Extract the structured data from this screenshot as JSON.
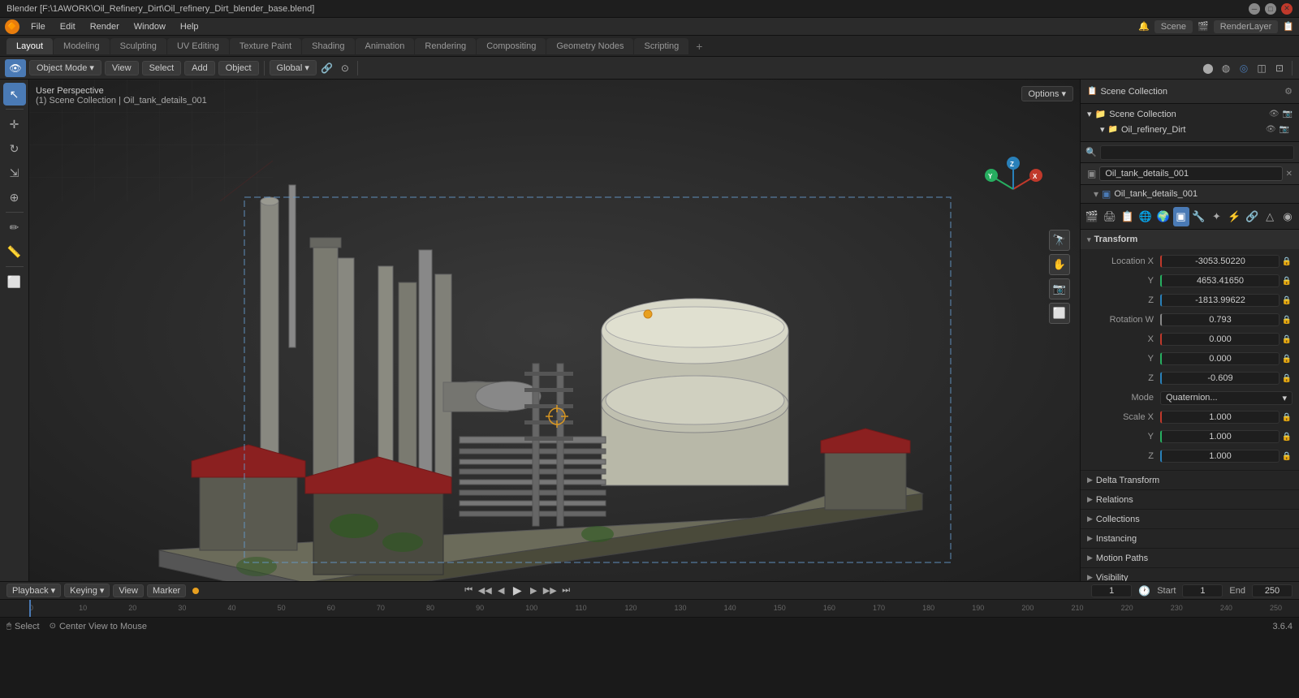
{
  "titleBar": {
    "title": "Blender [F:\\1AWORK\\Oil_Refinery_Dirt\\Oil_refinery_Dirt_blender_base.blend]",
    "minLabel": "─",
    "maxLabel": "□",
    "closeLabel": "✕"
  },
  "menuBar": {
    "items": [
      "Blender",
      "File",
      "Edit",
      "Render",
      "Window",
      "Help"
    ]
  },
  "workspaceTabs": {
    "tabs": [
      "Layout",
      "Modeling",
      "Sculpting",
      "UV Editing",
      "Texture Paint",
      "Shading",
      "Animation",
      "Rendering",
      "Compositing",
      "Geometry Nodes",
      "Scripting"
    ],
    "activeTab": "Layout",
    "plusLabel": "+"
  },
  "toolbar": {
    "modeLabel": "Object Mode",
    "viewLabel": "View",
    "selectLabel": "Select",
    "addLabel": "Add",
    "objectLabel": "Object",
    "globalLabel": "Global",
    "optionsLabel": "Options ▾"
  },
  "viewport": {
    "perspLabel": "User Perspective",
    "collectionPath": "(1) Scene Collection | Oil_tank_details_001"
  },
  "sceneCollection": {
    "rootLabel": "Scene Collection",
    "item": "Oil_refinery_Dirt"
  },
  "outliner": {
    "searchPlaceholder": "🔍",
    "selectedObject": "Oil_tank_details_001",
    "subObject": "Oil_tank_details_001"
  },
  "properties": {
    "objectName": "Oil_tank_details_001",
    "transform": {
      "sectionLabel": "Transform",
      "locationLabel": "Location X",
      "locationX": "-3053.50220",
      "locationY": "4653.41650",
      "locationZ": "-1813.99622",
      "rotationWLabel": "Rotation W",
      "rotationW": "0.793",
      "rotationX": "0.000",
      "rotationY": "0.000",
      "rotationZ": "-0.609",
      "modeLabel": "Mode",
      "modeValue": "Quaternion...",
      "scaleLabel": "Scale X",
      "scaleX": "1.000",
      "scaleY": "1.000",
      "scaleZ": "1.000"
    },
    "collapseItems": [
      {
        "label": "Delta Transform",
        "icon": "▶"
      },
      {
        "label": "Relations",
        "icon": "▶"
      },
      {
        "label": "Collections",
        "icon": "▶"
      },
      {
        "label": "Instancing",
        "icon": "▶"
      },
      {
        "label": "Motion Paths",
        "icon": "▶"
      },
      {
        "label": "Visibility",
        "icon": "▶"
      }
    ]
  },
  "timeline": {
    "playbackLabel": "Playback",
    "keyingLabel": "Keying",
    "viewLabel": "View",
    "markerLabel": "Marker",
    "currentFrame": "1",
    "startLabel": "Start",
    "startFrame": "1",
    "endLabel": "End",
    "endFrame": "250",
    "ticks": [
      0,
      10,
      20,
      30,
      40,
      50,
      60,
      70,
      80,
      90,
      100,
      110,
      120,
      130,
      140,
      150,
      160,
      170,
      180,
      190,
      200,
      210,
      220,
      230,
      240,
      250
    ]
  },
  "statusBar": {
    "selectHint": "Select",
    "centerHint": "Center View to Mouse",
    "versionLabel": "3.6.4"
  },
  "colors": {
    "accent": "#4a7ab5",
    "orange": "#e87d0d",
    "xAxis": "#c0392b",
    "yAxis": "#27ae60",
    "zAxis": "#2980b9"
  }
}
